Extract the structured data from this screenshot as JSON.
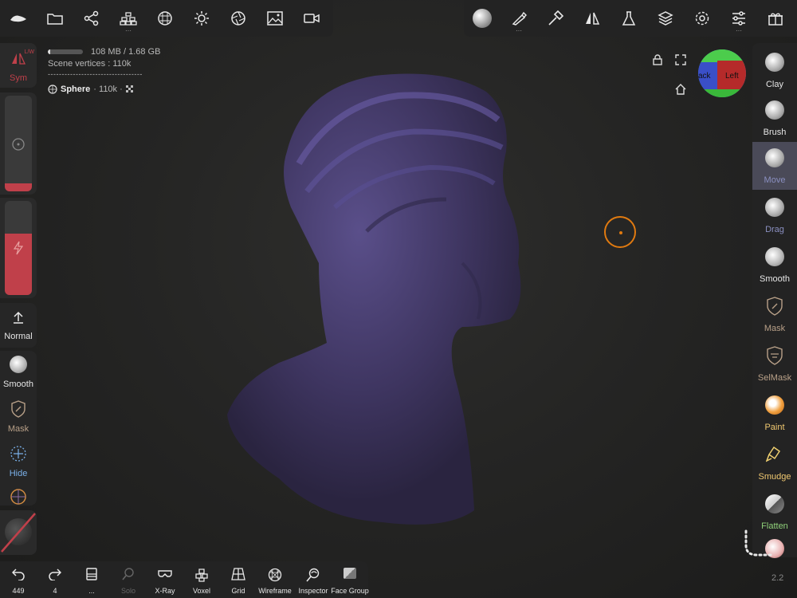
{
  "top_left_tools": [
    {
      "name": "logo-icon"
    },
    {
      "name": "folder-icon"
    },
    {
      "name": "share-icon"
    },
    {
      "name": "scene-icon"
    },
    {
      "name": "material-icon"
    },
    {
      "name": "light-icon"
    },
    {
      "name": "camera-icon"
    },
    {
      "name": "image-icon"
    },
    {
      "name": "video-icon"
    }
  ],
  "top_right_tools": [
    {
      "name": "brush-settings-icon"
    },
    {
      "name": "stroke-icon"
    },
    {
      "name": "hammer-icon"
    },
    {
      "name": "symmetry-icon"
    },
    {
      "name": "flask-icon"
    },
    {
      "name": "layers-icon"
    },
    {
      "name": "gear-icon"
    },
    {
      "name": "sliders-icon"
    },
    {
      "name": "gift-icon"
    }
  ],
  "info": {
    "memory": "108 MB / 1.68 GB",
    "memory_fraction": 0.065,
    "scene_vertices": "Scene vertices : 110k",
    "divider": "----------------------------------",
    "object_name": "Sphere",
    "object_detail": "· 110k ·"
  },
  "gizmo": {
    "left_label": "Left",
    "back_label": "ack"
  },
  "left": {
    "sym_label": "Sym",
    "sym_corner": "L/W",
    "radius_level": 0.08,
    "intensity_level": 0.65,
    "normal_label": "Normal",
    "smooth_label": "Smooth",
    "mask_label": "Mask",
    "hide_label": "Hide"
  },
  "right_tools": [
    {
      "label": "Clay",
      "color": "#d0d0d0",
      "label_color": "#e6e6e6"
    },
    {
      "label": "Brush",
      "color": "#d0d0d0",
      "label_color": "#e6e6e6"
    },
    {
      "label": "Move",
      "color": "#d0d0d0",
      "label_color": "#8a8fc0"
    },
    {
      "label": "Drag",
      "color": "#d0d0d0",
      "label_color": "#8a8fc0"
    },
    {
      "label": "Smooth",
      "color": "#d0d0d0",
      "label_color": "#e6e6e6"
    },
    {
      "label": "Mask",
      "color": "#c0a070",
      "label_color": "#b8a088"
    },
    {
      "label": "SelMask",
      "color": "#c0a070",
      "label_color": "#b8a088"
    },
    {
      "label": "Paint",
      "color": "#f0a040",
      "label_color": "#f0c870"
    },
    {
      "label": "Smudge",
      "color": "#f0d070",
      "label_color": "#f0c870"
    },
    {
      "label": "Flatten",
      "color": "#d0d0d0",
      "label_color": "#8fd07a"
    }
  ],
  "bottom_tools": [
    {
      "name": "undo-icon",
      "label": "449"
    },
    {
      "name": "redo-icon",
      "label": "4"
    },
    {
      "name": "history-icon",
      "label": "..."
    },
    {
      "name": "solo-icon",
      "label": "Solo"
    },
    {
      "name": "xray-icon",
      "label": "X-Ray"
    },
    {
      "name": "voxel-icon",
      "label": "Voxel"
    },
    {
      "name": "grid-icon",
      "label": "Grid"
    },
    {
      "name": "wireframe-icon",
      "label": "Wireframe"
    },
    {
      "name": "inspector-icon",
      "label": "Inspector"
    },
    {
      "name": "face-group-icon",
      "label": "Face Group"
    }
  ],
  "fps": "2.2",
  "colors": {
    "accent_red": "#c0404a",
    "cursor": "#e07a10",
    "model": "#4a4070",
    "active_tool": "#4a4a58"
  }
}
